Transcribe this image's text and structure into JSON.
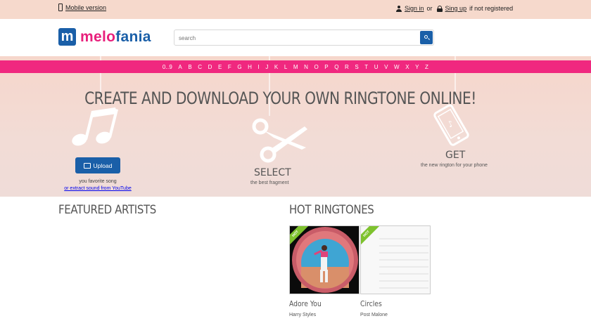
{
  "topbar": {
    "mobile_label": "Mobile version",
    "signin_label": "Sign in",
    "or_label": "or",
    "signup_label": "Sing up",
    "not_registered_label": "if not registered"
  },
  "header": {
    "logo_prefix": "melo",
    "logo_suffix": "fania",
    "search_placeholder": "search"
  },
  "alphabet": [
    "0..9",
    "A",
    "B",
    "C",
    "D",
    "E",
    "F",
    "G",
    "H",
    "I",
    "J",
    "K",
    "L",
    "M",
    "N",
    "O",
    "P",
    "Q",
    "R",
    "S",
    "T",
    "U",
    "V",
    "W",
    "X",
    "Y",
    "Z"
  ],
  "hero": {
    "title": "CREATE AND DOWNLOAD YOUR OWN RINGTONE ONLINE!",
    "upload_label": "Upload",
    "upload_desc_1": "you favorite song",
    "upload_desc_2": "or extract sound from YouTube",
    "select_label": "SELECT",
    "select_sub": "the best fragment",
    "get_label": "GET",
    "get_sub": "the new rington for your phone"
  },
  "featured_title": "FEATURED ARTISTS",
  "hot_title": "HOT RINGTONES",
  "hot_badge": "HOT",
  "ringtones": [
    {
      "title": "Adore You",
      "artist": "Harry Styles"
    },
    {
      "title": "Circles",
      "artist": "Post Malone"
    }
  ],
  "colors": {
    "brand_blue": "#1a5fa8",
    "brand_pink": "#f0287f",
    "hero_bg": "#f6d6cb",
    "hot_green": "#7ec22e"
  }
}
